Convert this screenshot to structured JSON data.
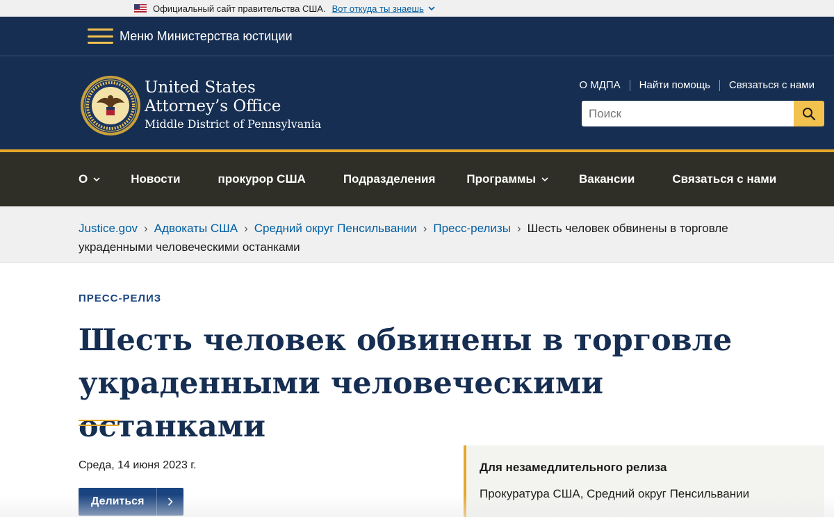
{
  "gov_banner": {
    "text": "Официальный сайт правительства США.",
    "link": "Вот откуда ты знаешь"
  },
  "menu": {
    "label": "Меню Министерства юстиции"
  },
  "header": {
    "office_line1": "United States",
    "office_line2": "Attorney’s Office",
    "office_line3": "Middle District of Pennsylvania",
    "util_links": [
      "О МДПА",
      "Найти помощь",
      "Связаться с нами"
    ],
    "search_placeholder": "Поиск"
  },
  "nav": {
    "items": [
      {
        "label": "О",
        "dropdown": true
      },
      {
        "label": "Новости",
        "dropdown": false
      },
      {
        "label": "прокурор США",
        "dropdown": false
      },
      {
        "label": "Подразделения",
        "dropdown": false
      },
      {
        "label": "Программы",
        "dropdown": true
      },
      {
        "label": "Вакансии",
        "dropdown": false
      },
      {
        "label": "Связаться с нами",
        "dropdown": false
      }
    ]
  },
  "breadcrumb": {
    "items": [
      "Justice.gov",
      "Адвокаты США",
      "Средний округ Пенсильвании",
      "Пресс-релизы"
    ],
    "current": "Шесть человек обвинены в торговле украденными человеческими останками"
  },
  "article": {
    "eyebrow": "ПРЕСС-РЕЛИЗ",
    "title": "Шесть человек обвинены в торговле украденными человеческими останками",
    "date": "Среда, 14 июня 2023 г.",
    "share_label": "Делиться"
  },
  "release_box": {
    "title": "Для незамедлительного релиза",
    "subtitle": "Прокуратура США, Средний округ Пенсильвании"
  },
  "colors": {
    "navy": "#162e51",
    "gold": "#e5a728",
    "nav_bg": "#2f2f27",
    "link": "#005ea2",
    "share_bg": "#1a4480"
  },
  "icons": {
    "flag": "us-flag-icon",
    "menu": "hamburger-icon",
    "search": "search-icon",
    "dropdown": "chevron-down-icon",
    "share": "chevron-right-icon",
    "seal": "doj-seal-icon"
  }
}
